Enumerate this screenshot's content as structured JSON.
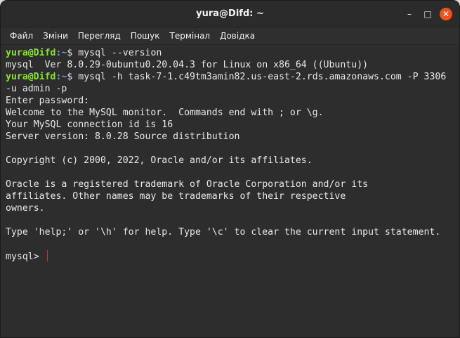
{
  "window": {
    "title": "yura@Difd: ~",
    "controls": {
      "minimize": "–",
      "maximize": "□",
      "close": "✕"
    }
  },
  "menu": [
    "Файл",
    "Зміни",
    "Перегляд",
    "Пошук",
    "Термінал",
    "Довідка"
  ],
  "prompt": {
    "user_host": "yura@Difd",
    "path": ":~",
    "symbol": "$"
  },
  "terminal": {
    "cmd1": " mysql --version",
    "out1": "mysql  Ver 8.0.29-0ubuntu0.20.04.3 for Linux on x86_64 ((Ubuntu))",
    "cmd2": " mysql -h task-7-1.c49tm3amin82.us-east-2.rds.amazonaws.com -P 3306",
    "cmd2_wrap": "-u admin -p",
    "lines": [
      "Enter password:",
      "Welcome to the MySQL monitor.  Commands end with ; or \\g.",
      "Your MySQL connection id is 16",
      "Server version: 8.0.28 Source distribution",
      "",
      "Copyright (c) 2000, 2022, Oracle and/or its affiliates.",
      "",
      "Oracle is a registered trademark of Oracle Corporation and/or its",
      "affiliates. Other names may be trademarks of their respective",
      "owners.",
      "",
      "Type 'help;' or '\\h' for help. Type '\\c' to clear the current input statement.",
      ""
    ],
    "mysql_prompt": "mysql> "
  },
  "colors": {
    "prompt_user": "#8ae234",
    "prompt_path": "#729fcf",
    "cursor": "#d32f2f",
    "close_button": "#e95420"
  }
}
